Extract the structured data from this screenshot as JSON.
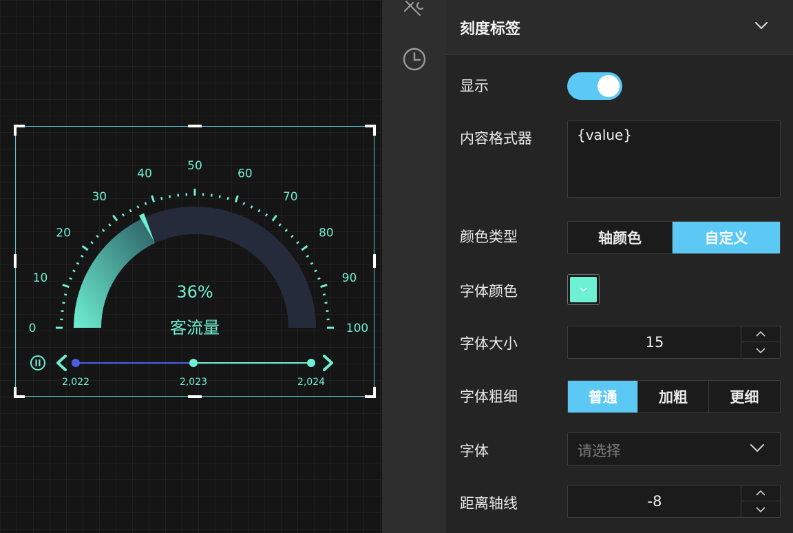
{
  "gauge": {
    "ticks": [
      "0",
      "10",
      "20",
      "30",
      "40",
      "50",
      "60",
      "70",
      "80",
      "90",
      "100"
    ],
    "value": 36,
    "percent_text": "36%",
    "name": "客流量",
    "track_color": "#262b3b",
    "fill_color_start": "#6ef0d2",
    "fill_color_end": "#2b5d63",
    "label_color": "#6ef0d2"
  },
  "timeline": {
    "years": [
      "2,022",
      "2,023",
      "2,024"
    ],
    "active_index": 0,
    "active_color": "#4a5fe6",
    "color": "#6ef0d2"
  },
  "panel": {
    "section_title": "刻度标签",
    "show_label": "显示",
    "show_on": true,
    "format_label": "内容格式器",
    "format_value": "{value}",
    "color_type_label": "颜色类型",
    "color_type_options": [
      "轴颜色",
      "自定义"
    ],
    "color_type_selected": 1,
    "font_color_label": "字体颜色",
    "font_color_value": "#6ef0d2",
    "font_size_label": "字体大小",
    "font_size_value": "15",
    "font_weight_label": "字体粗细",
    "font_weight_options": [
      "普通",
      "加粗",
      "更细"
    ],
    "font_weight_selected": 0,
    "font_label": "字体",
    "font_placeholder": "请选择",
    "distance_label": "距离轴线",
    "distance_value": "-8"
  }
}
